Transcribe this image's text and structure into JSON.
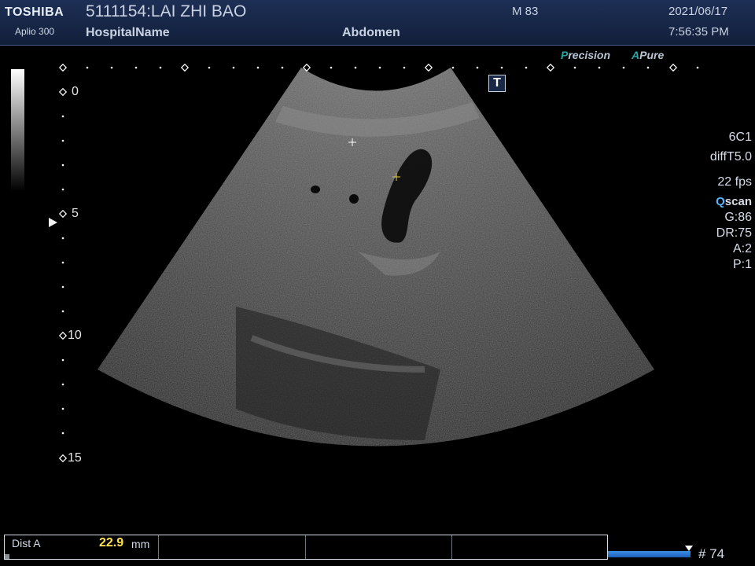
{
  "header": {
    "brand": "TOSHIBA",
    "model": "Aplio 300",
    "patient": "5111154:LAI ZHI BAO",
    "hospital": "HospitalName",
    "exam": "Abdomen",
    "mi": "M 83",
    "date": "2021/06/17",
    "time": "7:56:35 PM"
  },
  "modes": {
    "precision_p": "P",
    "precision_rest": "recision",
    "apure_a": "A",
    "apure_rest": "Pure"
  },
  "t_marker": "T",
  "depth_scale": {
    "labels": [
      "0",
      "5",
      "10",
      "15"
    ]
  },
  "params": {
    "probe": "6C1",
    "filter": "diffT5.0",
    "fps": "22 fps",
    "qscan_q": "Q",
    "qscan_rest": "scan",
    "gain": "G:86",
    "dr": "DR:75",
    "a": "A:2",
    "p": "P:1"
  },
  "measurement": {
    "label": "Dist A",
    "value": "22.9",
    "unit": "mm"
  },
  "cine": {
    "frame": "# 74"
  },
  "colors": {
    "header_bg": "#1b2c50",
    "accent_teal": "#2aa6a8",
    "measure_value": "#ffe34a",
    "cine_bar": "#2f7fd8",
    "qscan_q": "#55b6ff"
  }
}
